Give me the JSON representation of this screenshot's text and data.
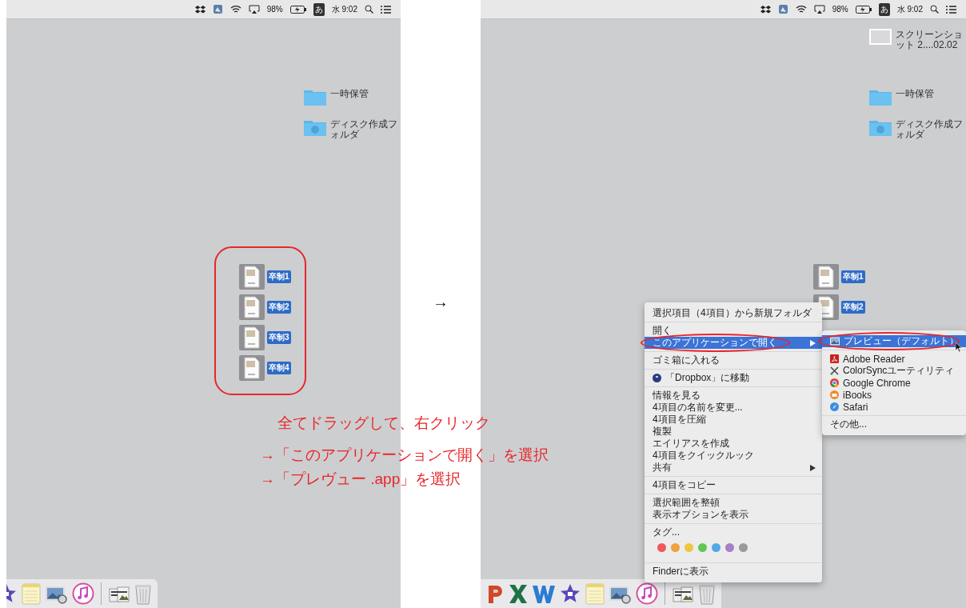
{
  "arrow": "→",
  "instructions": [
    "全てドラッグして、右クリック",
    "→「このアプリケーションで開く」を選択",
    "→「プレヴュー .app」を選択"
  ],
  "screens": [
    {
      "status": {
        "battery": "98%",
        "input_method": "あ",
        "clock": "水 9:02"
      },
      "desktop_icons": [
        {
          "kind": "folder",
          "label": "一時保管"
        },
        {
          "kind": "shared-folder",
          "label": "ディスク作成フォルダ"
        }
      ],
      "files": [
        {
          "label": "卒制1",
          "selected": true
        },
        {
          "label": "卒制2",
          "selected": true
        },
        {
          "label": "卒制3",
          "selected": true
        },
        {
          "label": "卒制4",
          "selected": true
        }
      ],
      "files_circled": true,
      "dock": [
        {
          "kind": "imovie"
        },
        {
          "kind": "notes"
        },
        {
          "kind": "preview"
        },
        {
          "kind": "itunes"
        },
        {
          "kind": "separator"
        },
        {
          "kind": "stack"
        },
        {
          "kind": "trash"
        }
      ]
    },
    {
      "status": {
        "battery": "98%",
        "input_method": "あ",
        "clock": "水 9:02"
      },
      "desktop_icons": [
        {
          "kind": "screenshot",
          "label": "スクリーンショット 2....02.02"
        },
        {
          "kind": "folder",
          "label": "一時保管"
        },
        {
          "kind": "shared-folder",
          "label": "ディスク作成フォルダ"
        }
      ],
      "files": [
        {
          "label": "卒制1",
          "selected": true
        },
        {
          "label": "卒制2",
          "selected": true
        }
      ],
      "files_circled": false,
      "context_menu": {
        "groups": [
          [
            {
              "kind": "item",
              "label": "選択項目（4項目）から新規フォルダ",
              "selected": false
            }
          ],
          [
            {
              "kind": "item",
              "label": "開く",
              "selected": false
            },
            {
              "kind": "item",
              "label": "このアプリケーションで開く",
              "selected": true,
              "has_submenu": true,
              "circled": true
            }
          ],
          [
            {
              "kind": "item",
              "label": "ゴミ箱に入れる",
              "selected": false
            }
          ],
          [
            {
              "kind": "dropbox-item",
              "label": "「Dropbox」に移動",
              "selected": false
            }
          ],
          [
            {
              "kind": "item",
              "label": "情報を見る",
              "selected": false
            },
            {
              "kind": "item",
              "label": "4項目の名前を変更...",
              "selected": false
            },
            {
              "kind": "item",
              "label": "4項目を圧縮",
              "selected": false
            },
            {
              "kind": "item",
              "label": "複製",
              "selected": false
            },
            {
              "kind": "item",
              "label": "エイリアスを作成",
              "selected": false
            },
            {
              "kind": "item",
              "label": "4項目をクイックルック",
              "selected": false
            },
            {
              "kind": "item",
              "label": "共有",
              "selected": false,
              "has_submenu": true
            }
          ],
          [
            {
              "kind": "item",
              "label": "4項目をコピー",
              "selected": false
            }
          ],
          [
            {
              "kind": "item",
              "label": "選択範囲を整頓",
              "selected": false
            },
            {
              "kind": "item",
              "label": "表示オプションを表示",
              "selected": false
            }
          ],
          [
            {
              "kind": "item",
              "label": "タグ...",
              "selected": false
            },
            {
              "kind": "tags",
              "tags": [
                {
                  "color": "#f0585a"
                },
                {
                  "color": "#f0a03c"
                },
                {
                  "color": "#ecc740"
                },
                {
                  "color": "#62c554"
                },
                {
                  "color": "#4ea9e6"
                },
                {
                  "color": "#a77fc3"
                },
                {
                  "color": "#9a9a9c"
                }
              ]
            }
          ],
          [
            {
              "kind": "item",
              "label": "Finderに表示",
              "selected": false
            }
          ]
        ]
      },
      "submenu": {
        "groups": [
          [
            {
              "kind": "app",
              "label": "プレビュー（デフォルト）",
              "selected": true,
              "circled": true
            }
          ],
          [
            {
              "kind": "app",
              "label": "Adobe Reader",
              "selected": false
            },
            {
              "kind": "app",
              "label": "ColorSyncユーティリティ",
              "selected": false
            },
            {
              "kind": "app",
              "label": "Google Chrome",
              "selected": false
            },
            {
              "kind": "app",
              "label": "iBooks",
              "selected": false
            },
            {
              "kind": "app",
              "label": "Safari",
              "selected": false
            }
          ],
          [
            {
              "kind": "item",
              "label": "その他...",
              "selected": false
            }
          ]
        ]
      },
      "dock": [
        {
          "kind": "powerpoint"
        },
        {
          "kind": "excel"
        },
        {
          "kind": "word"
        },
        {
          "kind": "imovie"
        },
        {
          "kind": "notes"
        },
        {
          "kind": "preview"
        },
        {
          "kind": "itunes"
        },
        {
          "kind": "separator"
        },
        {
          "kind": "stack"
        },
        {
          "kind": "trash"
        }
      ]
    }
  ]
}
